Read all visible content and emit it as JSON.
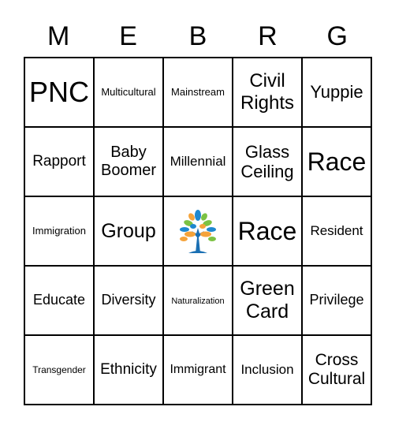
{
  "header": [
    "M",
    "E",
    "B",
    "R",
    "G"
  ],
  "cells": [
    [
      "PNC",
      "Multicultural",
      "Mainstream",
      "Civil Rights",
      "Yuppie"
    ],
    [
      "Rapport",
      "Baby Boomer",
      "Millennial",
      "Glass Ceiling",
      "Race"
    ],
    [
      "Immigration",
      "Group",
      "",
      "Race",
      "Resident"
    ],
    [
      "Educate",
      "Diversity",
      "Naturalization",
      "Green Card",
      "Privilege"
    ],
    [
      "Transgender",
      "Ethnicity",
      "Immigrant",
      "Inclusion",
      "Cross Cultural"
    ]
  ],
  "free_space_icon": "tree-logo-icon",
  "colors": {
    "leaf_blue": "#1e88d0",
    "leaf_green": "#7cc243",
    "leaf_orange": "#f5a33a",
    "trunk": "#1a6fb3"
  }
}
